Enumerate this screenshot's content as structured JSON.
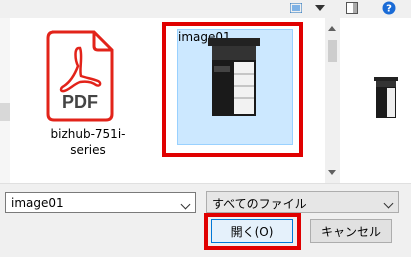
{
  "files": [
    {
      "name": "bizhub-751i-series",
      "type": "pdf",
      "icon": "pdf-icon",
      "icon_label": "PDF"
    },
    {
      "name": "image01",
      "type": "image",
      "selected": true,
      "icon": "printer-thumbnail"
    }
  ],
  "filename_input": {
    "value": "image01"
  },
  "filetype_select": {
    "value": "すべてのファイル"
  },
  "buttons": {
    "open": "開く(O)",
    "cancel": "キャンセル"
  },
  "colors": {
    "highlight": "#e00000",
    "selection": "#cce8ff",
    "pdf_red": "#e2231a"
  }
}
